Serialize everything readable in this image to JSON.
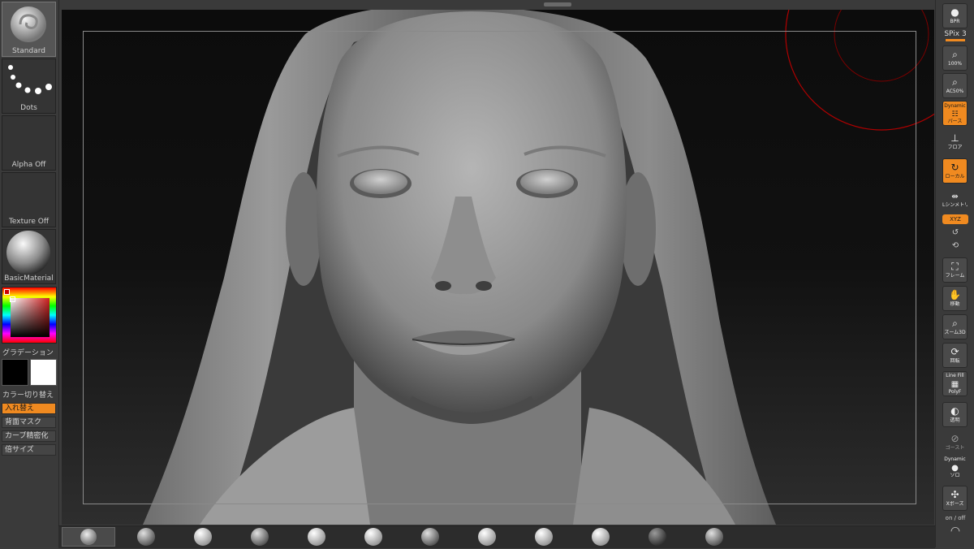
{
  "left_shelf": {
    "brush_label": "Standard",
    "stroke_label": "Dots",
    "alpha_label": "Alpha Off",
    "texture_label": "Texture Off",
    "material_label": "BasicMaterial",
    "gradient_label": "グラデーション",
    "color_switch_label": "カラー切り替え",
    "swap_label": "入れ替え",
    "back_mask_label": "背面マスク",
    "curve_density_label": "カーブ精密化",
    "double_size_label": "倍サイズ",
    "main_color": "#000000",
    "secondary_color": "#ffffff"
  },
  "right_shelf": {
    "bpr_label": "BPR",
    "spix_label": "SPix 3",
    "zoom100_label": "100%",
    "ac50_label": "AC50%",
    "perspective_top": "Dynamic",
    "perspective_label": "パース",
    "floor_label": "フロア",
    "local_label": "ローカル",
    "symmetry_label": "Lシンメトリ",
    "xyz_label": "XYZ",
    "frame_label": "フレーム",
    "move_label": "移動",
    "zoom3d_label": "ズーム3D",
    "rotate_label": "回転",
    "linefill_label": "Line Fill",
    "polyf_label": "PolyF",
    "transp_label": "透明",
    "ghost_label": "ゴースト",
    "solo_top": "Dynamic",
    "solo_label": "ソロ",
    "xpose_label": "Xポーズ",
    "onoff_label": "on / off",
    "accent_color": "#f08a20"
  },
  "bottom_shelf": {
    "material_slots": [
      "brush-thumb",
      "chrome-sphere",
      "striped-sphere",
      "cone-sphere",
      "split-sphere",
      "matte-sphere",
      "wedge-sphere",
      "halfdark-sphere",
      "toon-sphere",
      "white-sphere",
      "dark-sphere",
      "grey-sphere"
    ]
  },
  "viewport": {
    "model": "hooded female head sculpt"
  }
}
